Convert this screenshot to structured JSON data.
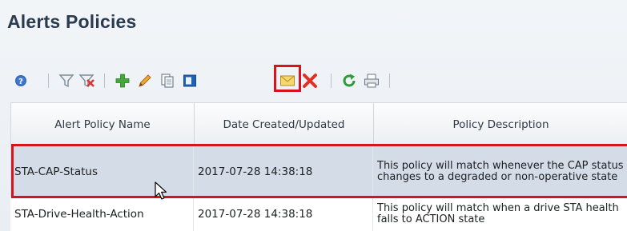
{
  "page": {
    "title": "Alerts Policies"
  },
  "toolbar": {
    "icons": [
      "help-icon",
      "filter-icon",
      "clear-filter-icon",
      "add-icon",
      "edit-icon",
      "copy-icon",
      "details-icon",
      "email-icon",
      "delete-icon",
      "refresh-icon",
      "print-icon"
    ]
  },
  "table": {
    "columns": [
      "Alert Policy Name",
      "Date Created/Updated",
      "Policy Description"
    ],
    "rows": [
      {
        "name": "STA-CAP-Status",
        "date": "2017-07-28 14:38:18",
        "description": "This policy will match whenever the CAP status changes to a degraded or non-operative state"
      },
      {
        "name": "STA-Drive-Health-Action",
        "date": "2017-07-28 14:38:18",
        "description": "This policy will match when a drive STA health falls to ACTION state"
      }
    ]
  },
  "colors": {
    "highlight": "#d6141f",
    "selected_row": "#d4dce8"
  }
}
